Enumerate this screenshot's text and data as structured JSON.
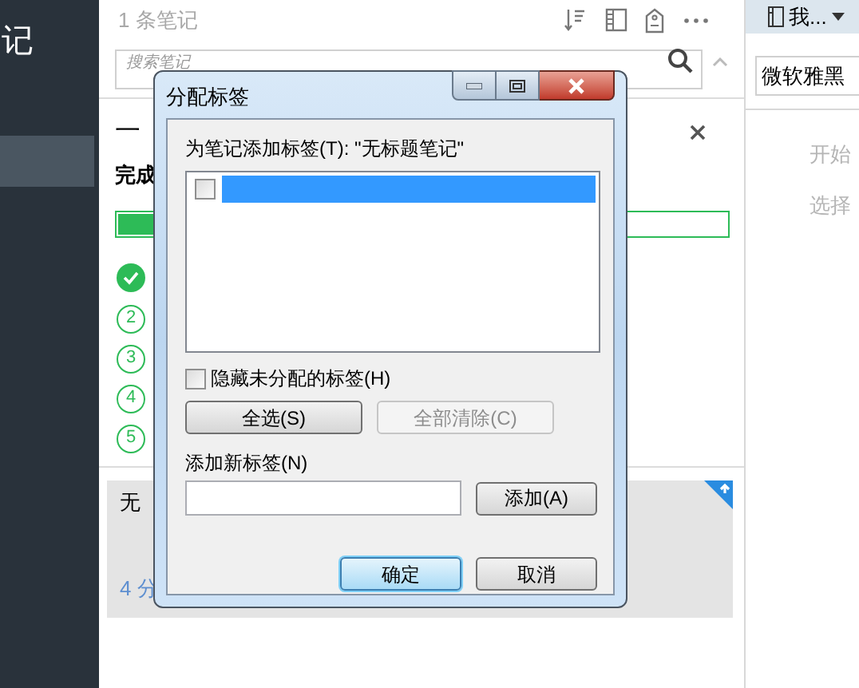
{
  "sidebar": {
    "title": "记",
    "items": [
      {
        "selected": true
      }
    ]
  },
  "note_list": {
    "count": "1 条笔记",
    "search": {
      "placeholder": "搜索笔记"
    },
    "guide": {
      "title": "一",
      "subtitle": "完成",
      "level": 0.06,
      "steps": [
        {
          "done": true
        },
        {
          "label": "2",
          "done": false
        },
        {
          "label": "3",
          "done": false
        },
        {
          "label": "4",
          "done": false
        },
        {
          "label": "5",
          "done": false
        }
      ]
    },
    "note": {
      "title": "无",
      "time": "4 分"
    }
  },
  "editor": {
    "notebook": "我...",
    "font": "微软雅黑",
    "hints": [
      "开始",
      "选择"
    ]
  },
  "dialog": {
    "title": "分配标签",
    "prompt": "为笔记添加标签(T): \"无标题笔记\"",
    "tags": [
      {
        "checked": false,
        "selected": true
      }
    ],
    "hide_unassigned": {
      "label": "隐藏未分配的标签(H)",
      "checked": false
    },
    "buttons": [
      {
        "label": "全选(S)",
        "disabled": false
      },
      {
        "label": "全部清除(C)",
        "disabled": true
      }
    ],
    "new_tag_label": "添加新标签(N)",
    "add_button": "添加(A)",
    "ok": "确定",
    "cancel": "取消"
  }
}
